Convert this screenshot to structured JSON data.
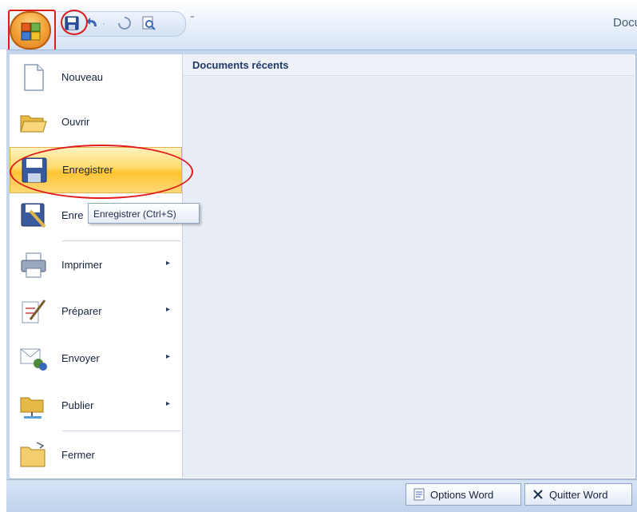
{
  "window": {
    "title": "Docu"
  },
  "office_button": {
    "name": "office-button"
  },
  "quick_access": {
    "items": [
      {
        "name": "save-icon"
      },
      {
        "name": "undo-icon"
      },
      {
        "name": "repeat-icon"
      },
      {
        "name": "print-preview-icon"
      }
    ],
    "separator": "·",
    "customize": "⁼"
  },
  "menu": {
    "items": [
      {
        "label": "Nouveau",
        "icon": "new-document-icon",
        "has_submenu": false
      },
      {
        "label": "Ouvrir",
        "icon": "open-folder-icon",
        "has_submenu": false
      },
      {
        "label": "Enregistrer",
        "icon": "save-icon",
        "has_submenu": false,
        "highlighted": true
      },
      {
        "label": "Enre",
        "icon": "save-as-icon",
        "has_submenu": false
      },
      {
        "label": "Imprimer",
        "icon": "printer-icon",
        "has_submenu": true
      },
      {
        "label": "Préparer",
        "icon": "prepare-icon",
        "has_submenu": true
      },
      {
        "label": "Envoyer",
        "icon": "send-icon",
        "has_submenu": true
      },
      {
        "label": "Publier",
        "icon": "publish-icon",
        "has_submenu": true
      },
      {
        "label": "Fermer",
        "icon": "close-folder-icon",
        "has_submenu": false
      }
    ],
    "submenu_arrow": "▸"
  },
  "tooltip": {
    "text": "Enregistrer (Ctrl+S)"
  },
  "recent": {
    "title": "Documents récents"
  },
  "bottom": {
    "options_label": "Options Word",
    "quit_label": "Quitter Word"
  },
  "colors": {
    "annotation": "#e01b1b",
    "hover": "#ffc332",
    "frame": "#c5d6ec"
  }
}
